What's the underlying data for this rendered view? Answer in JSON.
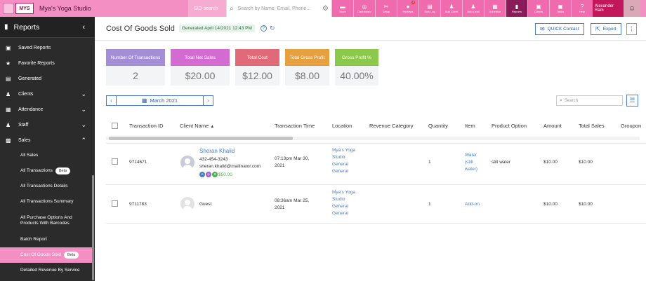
{
  "topbar": {
    "studio_name": "Mya's Yoga Studio",
    "logo_text": "MYS",
    "sid_placeholder": "SID search",
    "search_placeholder": "Search by Name, Email, Phone...",
    "nav": [
      {
        "label": "Store",
        "icon": "store-icon"
      },
      {
        "label": "Dashboard",
        "icon": "dashboard-icon"
      },
      {
        "label": "Setup",
        "icon": "tools-icon"
      },
      {
        "label": "Reviews",
        "icon": "chat-icon",
        "badge": "8"
      },
      {
        "label": "Sick Log",
        "icon": "log-icon"
      },
      {
        "label": "Add Client",
        "icon": "add-user-icon"
      },
      {
        "label": "Add Lead",
        "icon": "add-lead-icon"
      },
      {
        "label": "Schedule",
        "icon": "calendar-icon"
      },
      {
        "label": "Reports",
        "icon": "bar-chart-icon"
      },
      {
        "label": "Clients",
        "icon": "clients-icon"
      },
      {
        "label": "Tasks",
        "icon": "tasks-icon"
      },
      {
        "label": "Help",
        "icon": "help-icon"
      }
    ],
    "user_name": "Alexander Ram"
  },
  "sidebar": {
    "header": "Reports",
    "items": [
      {
        "label": "Saved Reports"
      },
      {
        "label": "Favorite Reports"
      },
      {
        "label": "Generated"
      },
      {
        "label": "Clients"
      },
      {
        "label": "Attendance"
      },
      {
        "label": "Staff"
      },
      {
        "label": "Sales"
      }
    ],
    "sub_items": [
      {
        "label": "All Sales"
      },
      {
        "label": "All Transactions",
        "badge": "Beta"
      },
      {
        "label": "All Transactions Details"
      },
      {
        "label": "All Transactions Summary"
      },
      {
        "label": "All Purchase Options And Products With Barcodes"
      },
      {
        "label": "Batch Report"
      },
      {
        "label": "Cost Of Goods Sold",
        "badge": "Beta"
      },
      {
        "label": "Detailed Revenue By Service"
      }
    ]
  },
  "main": {
    "title": "Cost Of Goods Sold",
    "generated": "Generated April 14/2021 12:43 PM",
    "quick_contact": "QUICK Contact",
    "export": "Export",
    "cards": [
      {
        "label": "Number Of Transactions",
        "value": "2",
        "color": "#a48fd6"
      },
      {
        "label": "Total Net Sales",
        "value": "$20.00",
        "color": "#d46bd1"
      },
      {
        "label": "Total Cost",
        "value": "$12.00",
        "color": "#e06a78"
      },
      {
        "label": "Total Gross Profit",
        "value": "$8.00",
        "color": "#e6a040"
      },
      {
        "label": "Gross Profit %",
        "value": "40.00%",
        "color": "#8cc84b"
      }
    ],
    "month": "March 2021",
    "search_placeholder": "Search",
    "columns": [
      "Transaction ID",
      "Client Name",
      "Transaction Time",
      "Location",
      "Revenue Category",
      "Quantity",
      "Item",
      "Product Option",
      "Amount",
      "Total Sales",
      "Groupon"
    ],
    "rows": [
      {
        "id": "9714671",
        "client": "Sheran Khalid",
        "phone": "432-454-3243",
        "email": "sheran.khalid@mailinator.com",
        "credit": "$50.00",
        "time": "07:13pm Mar 30, 2021",
        "location": "Mya's Yoga Studio General General",
        "category": "",
        "quantity": "1",
        "item": "Water (still water)",
        "option": "still water",
        "amount": "$10.00",
        "total": "$10.00"
      },
      {
        "id": "9711783",
        "client": "Guest",
        "time": "08:36am Mar 25, 2021",
        "location": "Mya's Yoga Studio General General",
        "category": "",
        "quantity": "1",
        "item": "Add-on",
        "option": "",
        "amount": "$10.00",
        "total": "$10.00"
      }
    ]
  }
}
